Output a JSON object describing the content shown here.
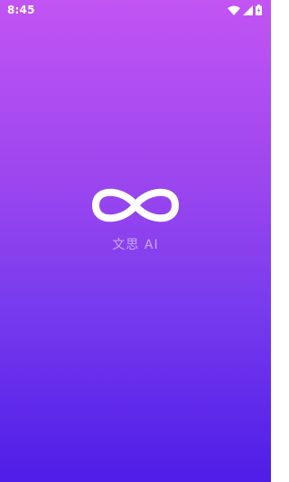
{
  "status_bar": {
    "time": "8:45",
    "icons": [
      "wifi-icon",
      "cell-signal-icon",
      "battery-icon"
    ]
  },
  "splash": {
    "logo_icon": "infinity-icon",
    "app_name": "文思 AI"
  },
  "colors": {
    "gradient_top": "#c254f3",
    "gradient_bottom": "#4f1de8",
    "logo": "#ffffff",
    "app_name_text": "rgba(255,255,255,0.55)"
  }
}
